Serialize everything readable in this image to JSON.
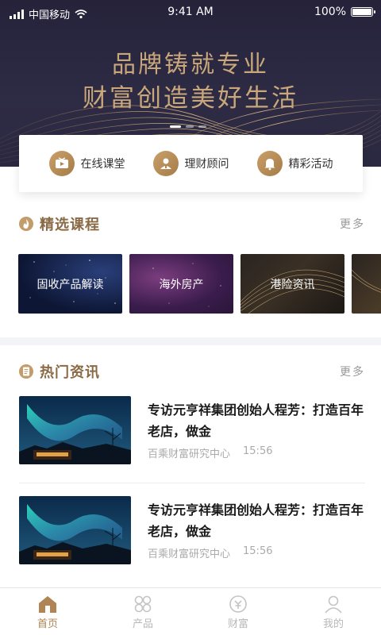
{
  "status_bar": {
    "carrier": "中国移动",
    "time": "9:41 AM",
    "battery": "100%",
    "battery_level": 1.0
  },
  "banner": {
    "line1": "品牌铸就专业",
    "line2": "财富创造美好生活",
    "slide_count": 3,
    "active_slide": 0
  },
  "quick_links": [
    {
      "label": "在线课堂",
      "icon": "video-class-icon"
    },
    {
      "label": "理财顾问",
      "icon": "advisor-icon"
    },
    {
      "label": "精彩活动",
      "icon": "bell-icon"
    }
  ],
  "courses_section": {
    "title": "精选课程",
    "more": "更多",
    "items": [
      {
        "label": "固收产品解读"
      },
      {
        "label": "海外房产"
      },
      {
        "label": "港险资讯"
      },
      {
        "label": ""
      }
    ]
  },
  "news_section": {
    "title": "热门资讯",
    "more": "更多",
    "items": [
      {
        "headline": "专访元亨祥集团创始人程芳：打造百年老店，做金",
        "source": "百乘财富研究中心",
        "time": "15:56"
      },
      {
        "headline": "专访元亨祥集团创始人程芳：打造百年老店，做金",
        "source": "百乘财富研究中心",
        "time": "15:56"
      }
    ]
  },
  "tab_bar": {
    "tabs": [
      {
        "label": "首页",
        "icon": "home-icon",
        "active": true
      },
      {
        "label": "产品",
        "icon": "products-icon",
        "active": false
      },
      {
        "label": "财富",
        "icon": "wealth-icon",
        "active": false
      },
      {
        "label": "我的",
        "icon": "profile-icon",
        "active": false
      }
    ]
  },
  "colors": {
    "accent": "#b08454",
    "banner_bg": "#2b2842",
    "banner_text": "#c9a77a"
  }
}
